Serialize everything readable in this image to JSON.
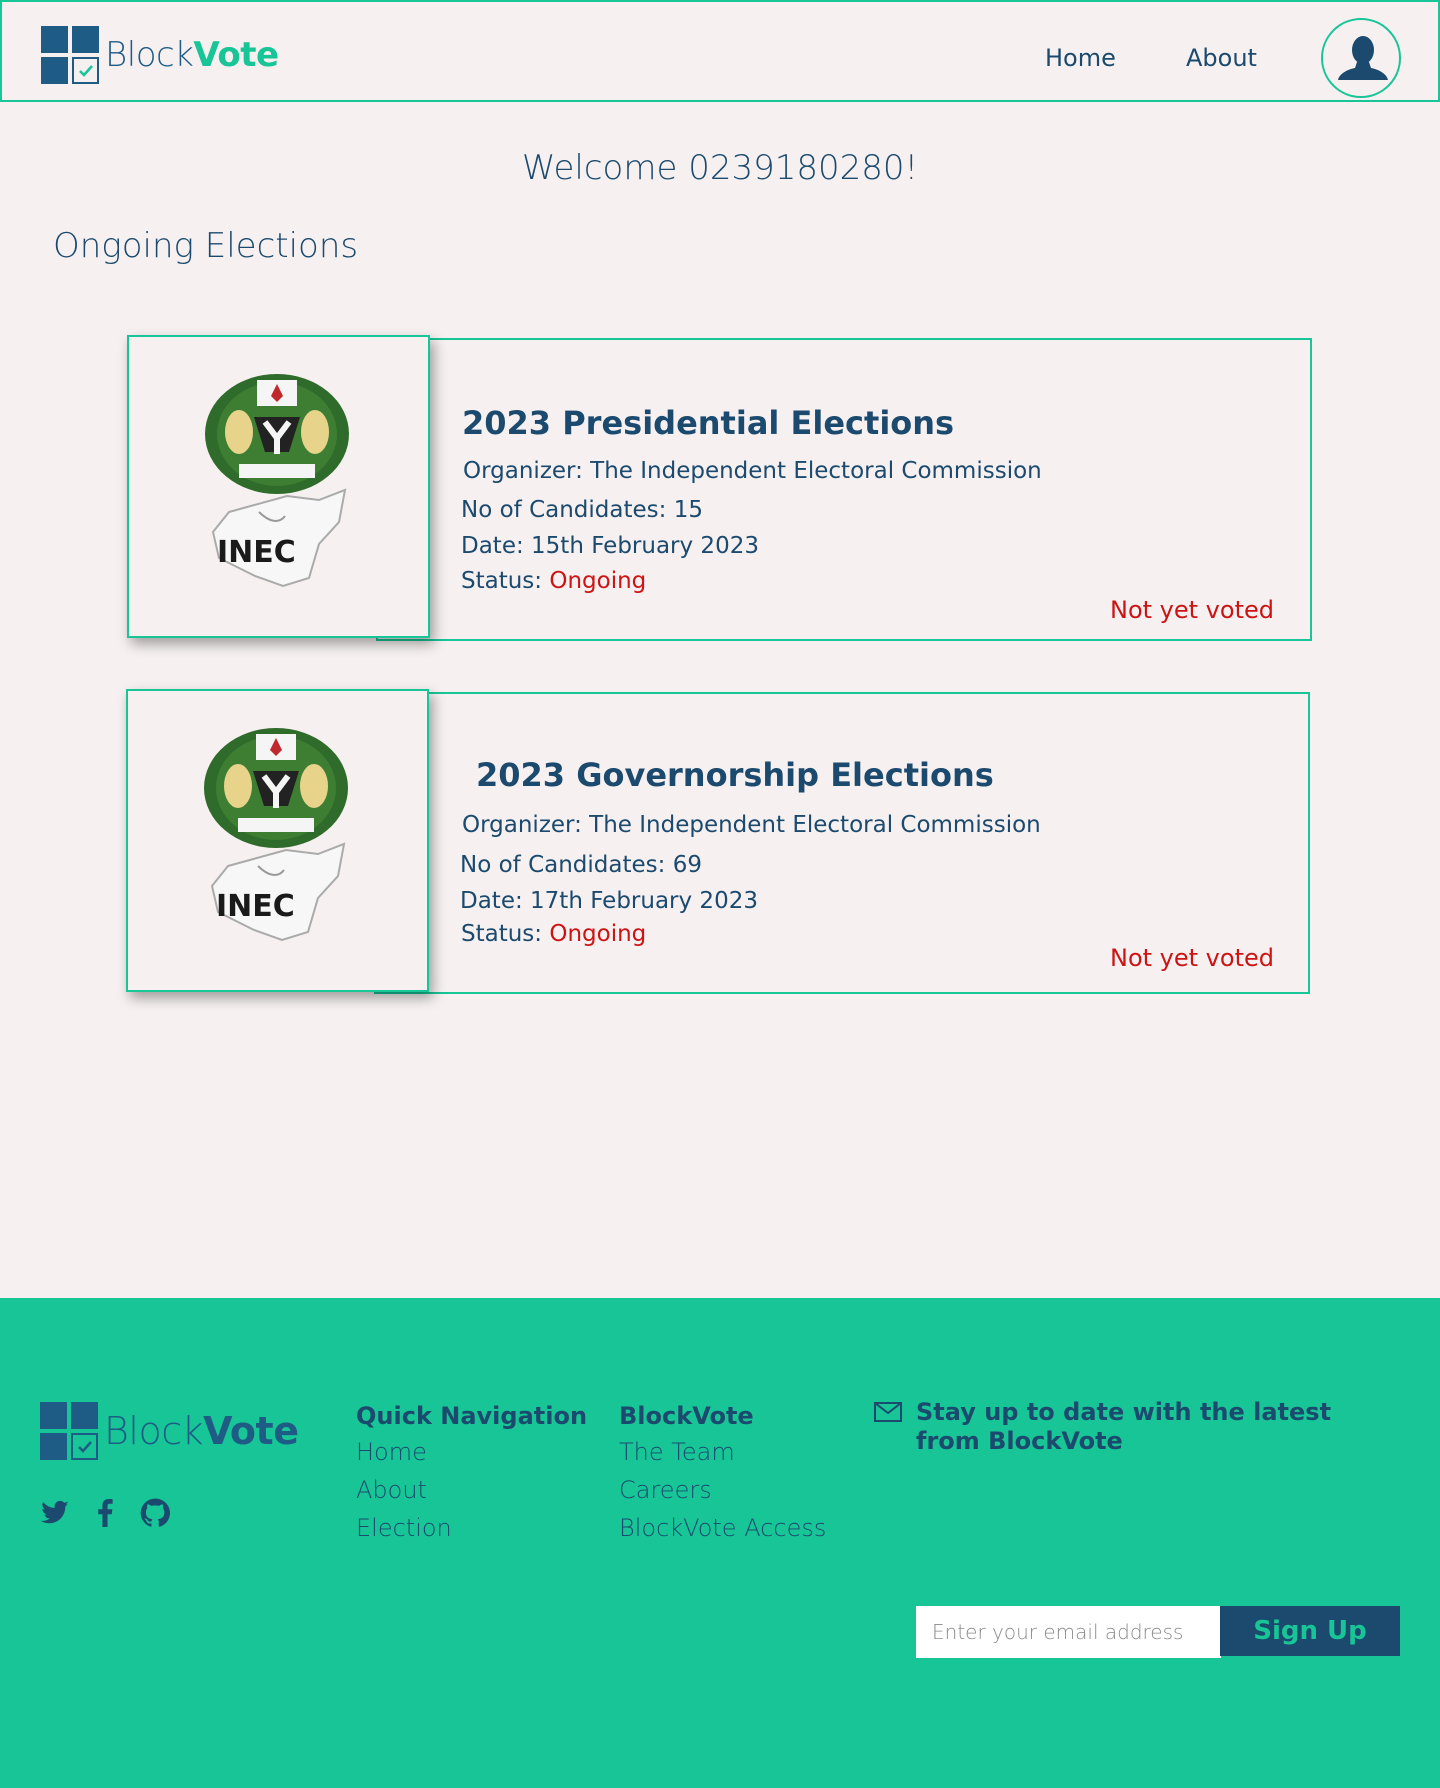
{
  "header": {
    "brand_light": "Block",
    "brand_bold": "Vote",
    "nav": {
      "home": "Home",
      "about": "About"
    }
  },
  "main": {
    "welcome": "Welcome 0239180280!",
    "section_title": "Ongoing Elections",
    "elections": [
      {
        "title": "2023 Presidential Elections",
        "organizer": "Organizer: The Independent Electoral Commission",
        "candidates": "No of Candidates: 15",
        "date": "Date: 15th February 2023",
        "status_label": "Status: ",
        "status_value": "Ongoing",
        "vote_state": "Not yet voted",
        "logo_text": "INEC"
      },
      {
        "title": "2023 Governorship Elections",
        "organizer": "Organizer: The Independent Electoral Commission",
        "candidates": "No of Candidates: 69",
        "date": "Date: 17th February 2023",
        "status_label": "Status: ",
        "status_value": "Ongoing",
        "vote_state": "Not yet voted",
        "logo_text": "INEC"
      }
    ]
  },
  "footer": {
    "brand_light": "Block",
    "brand_bold": "Vote",
    "quick_nav": {
      "heading": "Quick Navigation",
      "links": [
        "Home",
        "About",
        "Election"
      ]
    },
    "company": {
      "heading": "BlockVote",
      "links": [
        "The Team",
        "Careers",
        "BlockVote Access"
      ]
    },
    "newsletter": {
      "text": "Stay up to date with the latest from BlockVote",
      "placeholder": "Enter your email address",
      "button": "Sign Up"
    },
    "socials": [
      "twitter-icon",
      "facebook-icon",
      "github-icon"
    ]
  },
  "colors": {
    "accent": "#17c596",
    "navy": "#1b4a6e",
    "status": "#cc1414",
    "background": "#f6f0f0"
  }
}
